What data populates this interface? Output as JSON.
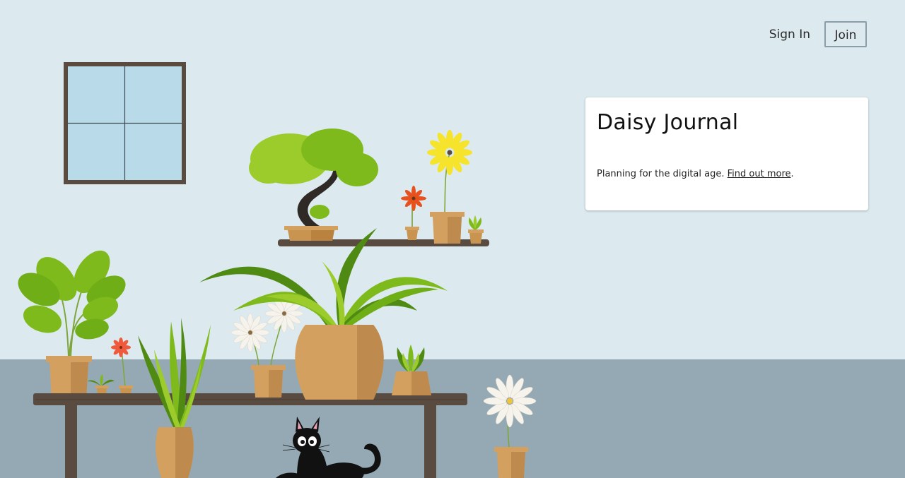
{
  "nav": {
    "sign_in": "Sign In",
    "join": "Join"
  },
  "card": {
    "title": "Daisy Journal",
    "tagline": "Planning for the digital age.",
    "link": "Find out more",
    "link_suffix": "."
  },
  "colors": {
    "wall": "#dceaf0",
    "floor": "#94a9b3",
    "wood": "#5a4b40",
    "pot": "#d3a05f",
    "pot_shade": "#bf8a4e",
    "leaf_light": "#9ccc2c",
    "leaf_dark": "#4f8a12",
    "window_glass": "#b9dbe9"
  }
}
